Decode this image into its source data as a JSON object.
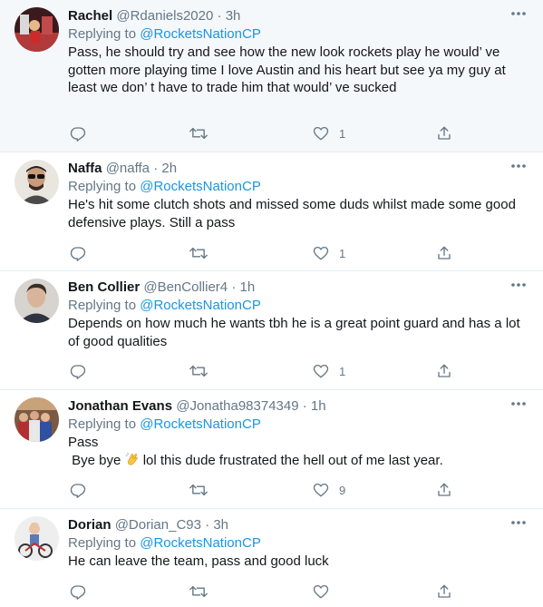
{
  "colors": {
    "link": "#1b95e0",
    "muted": "#657786",
    "text": "#14171a",
    "highlight_bg": "#f5f8fa",
    "divider": "#e6ecf0"
  },
  "tweets": [
    {
      "name": "Rachel",
      "handle": "@Rdaniels2020",
      "dot": "·",
      "time": "3h",
      "replying_prefix": "Replying to ",
      "replying_to": "@RocketsNationCP",
      "text": "Pass, he should try and see how the new look rockets play he would’ ve gotten more playing time I love Austin and his heart but see ya my guy at least we don’ t have to trade him that would’ ve sucked",
      "reply_count": "",
      "retweet_count": "",
      "like_count": "1",
      "avatar_icon": "avatar-basketball-arena"
    },
    {
      "name": "Naffa",
      "handle": "@naffa",
      "dot": "·",
      "time": "2h",
      "replying_prefix": "Replying to ",
      "replying_to": "@RocketsNationCP",
      "text": "He's hit some clutch shots and missed some duds whilst made some good defensive plays. Still a pass",
      "reply_count": "",
      "retweet_count": "",
      "like_count": "1",
      "avatar_icon": "avatar-man-sunglasses"
    },
    {
      "name": "Ben Collier",
      "handle": "@BenCollier4",
      "dot": "·",
      "time": "1h",
      "replying_prefix": "Replying to ",
      "replying_to": "@RocketsNationCP",
      "text": "Depends on how much he wants tbh he is a great point guard and has a lot of good qualities",
      "reply_count": "",
      "retweet_count": "",
      "like_count": "1",
      "avatar_icon": "avatar-man-portrait"
    },
    {
      "name": "Jonathan Evans",
      "handle": "@Jonatha98374349",
      "dot": "·",
      "time": "1h",
      "replying_prefix": "Replying to ",
      "replying_to": "@RocketsNationCP",
      "text_line1": "Pass",
      "text_line2_pre": " Bye bye ",
      "text_emoji": "waving-hand-emoji",
      "text_line2_post": " lol this dude frustrated the hell out of me last year.",
      "reply_count": "",
      "retweet_count": "",
      "like_count": "9",
      "avatar_icon": "avatar-group-photo"
    },
    {
      "name": "Dorian",
      "handle": "@Dorian_C93",
      "dot": "·",
      "time": "3h",
      "replying_prefix": "Replying to ",
      "replying_to": "@RocketsNationCP",
      "text": "He can leave the team, pass and good luck",
      "reply_count": "",
      "retweet_count": "",
      "like_count": "",
      "avatar_icon": "avatar-child-bike"
    }
  ]
}
